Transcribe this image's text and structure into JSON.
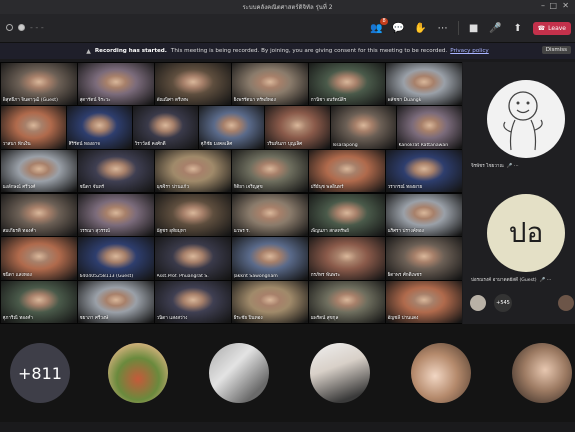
{
  "window": {
    "title": "ระบบคลังคณิตศาสตร์ดิจิทัล รุ่นที่ 2"
  },
  "toolbar": {
    "chat_badge": "8",
    "leave_label": "Leave"
  },
  "banner": {
    "headline": "Recording has started.",
    "message": "This meeting is being recorded. By joining, you are giving consent for this meeting to be recorded.",
    "privacy_link": "Privacy policy",
    "dismiss_label": "Dismiss"
  },
  "participants": [
    "พิสุทธิ์ภา จินดาวุฒิ (Guest)",
    "สุดารัตน์ จิระวะ",
    "พัณณิศา ตรีเทพ",
    "ยิ่งพรรัตนา ทรัพย์ทอง",
    "ภานิชา อนรัตน์สิร",
    "พลัชชา Duangk",
    "วาสนา ฟักเงิน",
    "ศิริรัตน์ ทองอาจ",
    "วิราวัลย์ คงศักดิ์",
    "ศุภิชัย มงคลเลิศ",
    "วรินท์นภา บุญเลิศ",
    "Issarapong",
    "Kanokrat Rattanawan",
    "นงลักษณ์ ศรีวงศ์",
    "ชนิดา จันทร์",
    "นุชจิรา ปานแก้ว",
    "กิติยา เจริญสุข",
    "ปรีย์นุช พลอินทร์",
    "วรากรณ์ ทองผาย",
    "สมเกียรติ ทองคำ",
    "วรรณา สุวรรณ์",
    "นัฐชร อุทัยมุทา",
    "นวพร ร.",
    "เพ็ญนภา สกลทรัพย์",
    "นริศรา ปรางค์ทอง",
    "ชนิดา แสงทอง",
    "640405258113 (Guest)",
    "Asst.Prof. Phuangrat S.",
    "Jakkrit Sawongnam",
    "ภรภัทร พันพระ",
    "ธิดาพร ศักดิ์เพชร",
    "ศุภาริณี ทองคำ",
    "ชยาภา ศรีวงษ์",
    "วนิดา แสงสว่าง",
    "ธีระชัย ปิ่นทอง",
    "นพรัตน์ สุขกุล",
    "อัญชลี ปานแดง",
    "ชญานิศา พรหมมา"
  ],
  "side_panel": {
    "person1_name": "จิรพัชร ไชยวาณ",
    "person2_initials": "ปอ",
    "person2_name": "ปอรณรงค์ อามาดดยัสดี (Guest)",
    "mini_count": "+545"
  },
  "overflow_count": "+811",
  "colors": {
    "accent": "#6264a7",
    "leave": "#c4314b",
    "overflow_bg": "#3e3e48"
  }
}
